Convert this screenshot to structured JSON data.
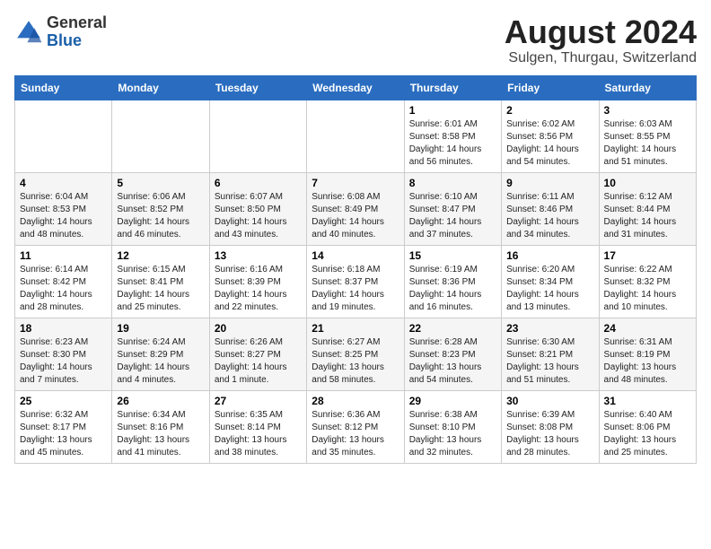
{
  "header": {
    "logo_general": "General",
    "logo_blue": "Blue",
    "month_title": "August 2024",
    "location": "Sulgen, Thurgau, Switzerland"
  },
  "weekdays": [
    "Sunday",
    "Monday",
    "Tuesday",
    "Wednesday",
    "Thursday",
    "Friday",
    "Saturday"
  ],
  "weeks": [
    [
      {
        "day": "",
        "sunrise": "",
        "sunset": "",
        "daylight": ""
      },
      {
        "day": "",
        "sunrise": "",
        "sunset": "",
        "daylight": ""
      },
      {
        "day": "",
        "sunrise": "",
        "sunset": "",
        "daylight": ""
      },
      {
        "day": "",
        "sunrise": "",
        "sunset": "",
        "daylight": ""
      },
      {
        "day": "1",
        "sunrise": "Sunrise: 6:01 AM",
        "sunset": "Sunset: 8:58 PM",
        "daylight": "Daylight: 14 hours and 56 minutes."
      },
      {
        "day": "2",
        "sunrise": "Sunrise: 6:02 AM",
        "sunset": "Sunset: 8:56 PM",
        "daylight": "Daylight: 14 hours and 54 minutes."
      },
      {
        "day": "3",
        "sunrise": "Sunrise: 6:03 AM",
        "sunset": "Sunset: 8:55 PM",
        "daylight": "Daylight: 14 hours and 51 minutes."
      }
    ],
    [
      {
        "day": "4",
        "sunrise": "Sunrise: 6:04 AM",
        "sunset": "Sunset: 8:53 PM",
        "daylight": "Daylight: 14 hours and 48 minutes."
      },
      {
        "day": "5",
        "sunrise": "Sunrise: 6:06 AM",
        "sunset": "Sunset: 8:52 PM",
        "daylight": "Daylight: 14 hours and 46 minutes."
      },
      {
        "day": "6",
        "sunrise": "Sunrise: 6:07 AM",
        "sunset": "Sunset: 8:50 PM",
        "daylight": "Daylight: 14 hours and 43 minutes."
      },
      {
        "day": "7",
        "sunrise": "Sunrise: 6:08 AM",
        "sunset": "Sunset: 8:49 PM",
        "daylight": "Daylight: 14 hours and 40 minutes."
      },
      {
        "day": "8",
        "sunrise": "Sunrise: 6:10 AM",
        "sunset": "Sunset: 8:47 PM",
        "daylight": "Daylight: 14 hours and 37 minutes."
      },
      {
        "day": "9",
        "sunrise": "Sunrise: 6:11 AM",
        "sunset": "Sunset: 8:46 PM",
        "daylight": "Daylight: 14 hours and 34 minutes."
      },
      {
        "day": "10",
        "sunrise": "Sunrise: 6:12 AM",
        "sunset": "Sunset: 8:44 PM",
        "daylight": "Daylight: 14 hours and 31 minutes."
      }
    ],
    [
      {
        "day": "11",
        "sunrise": "Sunrise: 6:14 AM",
        "sunset": "Sunset: 8:42 PM",
        "daylight": "Daylight: 14 hours and 28 minutes."
      },
      {
        "day": "12",
        "sunrise": "Sunrise: 6:15 AM",
        "sunset": "Sunset: 8:41 PM",
        "daylight": "Daylight: 14 hours and 25 minutes."
      },
      {
        "day": "13",
        "sunrise": "Sunrise: 6:16 AM",
        "sunset": "Sunset: 8:39 PM",
        "daylight": "Daylight: 14 hours and 22 minutes."
      },
      {
        "day": "14",
        "sunrise": "Sunrise: 6:18 AM",
        "sunset": "Sunset: 8:37 PM",
        "daylight": "Daylight: 14 hours and 19 minutes."
      },
      {
        "day": "15",
        "sunrise": "Sunrise: 6:19 AM",
        "sunset": "Sunset: 8:36 PM",
        "daylight": "Daylight: 14 hours and 16 minutes."
      },
      {
        "day": "16",
        "sunrise": "Sunrise: 6:20 AM",
        "sunset": "Sunset: 8:34 PM",
        "daylight": "Daylight: 14 hours and 13 minutes."
      },
      {
        "day": "17",
        "sunrise": "Sunrise: 6:22 AM",
        "sunset": "Sunset: 8:32 PM",
        "daylight": "Daylight: 14 hours and 10 minutes."
      }
    ],
    [
      {
        "day": "18",
        "sunrise": "Sunrise: 6:23 AM",
        "sunset": "Sunset: 8:30 PM",
        "daylight": "Daylight: 14 hours and 7 minutes."
      },
      {
        "day": "19",
        "sunrise": "Sunrise: 6:24 AM",
        "sunset": "Sunset: 8:29 PM",
        "daylight": "Daylight: 14 hours and 4 minutes."
      },
      {
        "day": "20",
        "sunrise": "Sunrise: 6:26 AM",
        "sunset": "Sunset: 8:27 PM",
        "daylight": "Daylight: 14 hours and 1 minute."
      },
      {
        "day": "21",
        "sunrise": "Sunrise: 6:27 AM",
        "sunset": "Sunset: 8:25 PM",
        "daylight": "Daylight: 13 hours and 58 minutes."
      },
      {
        "day": "22",
        "sunrise": "Sunrise: 6:28 AM",
        "sunset": "Sunset: 8:23 PM",
        "daylight": "Daylight: 13 hours and 54 minutes."
      },
      {
        "day": "23",
        "sunrise": "Sunrise: 6:30 AM",
        "sunset": "Sunset: 8:21 PM",
        "daylight": "Daylight: 13 hours and 51 minutes."
      },
      {
        "day": "24",
        "sunrise": "Sunrise: 6:31 AM",
        "sunset": "Sunset: 8:19 PM",
        "daylight": "Daylight: 13 hours and 48 minutes."
      }
    ],
    [
      {
        "day": "25",
        "sunrise": "Sunrise: 6:32 AM",
        "sunset": "Sunset: 8:17 PM",
        "daylight": "Daylight: 13 hours and 45 minutes."
      },
      {
        "day": "26",
        "sunrise": "Sunrise: 6:34 AM",
        "sunset": "Sunset: 8:16 PM",
        "daylight": "Daylight: 13 hours and 41 minutes."
      },
      {
        "day": "27",
        "sunrise": "Sunrise: 6:35 AM",
        "sunset": "Sunset: 8:14 PM",
        "daylight": "Daylight: 13 hours and 38 minutes."
      },
      {
        "day": "28",
        "sunrise": "Sunrise: 6:36 AM",
        "sunset": "Sunset: 8:12 PM",
        "daylight": "Daylight: 13 hours and 35 minutes."
      },
      {
        "day": "29",
        "sunrise": "Sunrise: 6:38 AM",
        "sunset": "Sunset: 8:10 PM",
        "daylight": "Daylight: 13 hours and 32 minutes."
      },
      {
        "day": "30",
        "sunrise": "Sunrise: 6:39 AM",
        "sunset": "Sunset: 8:08 PM",
        "daylight": "Daylight: 13 hours and 28 minutes."
      },
      {
        "day": "31",
        "sunrise": "Sunrise: 6:40 AM",
        "sunset": "Sunset: 8:06 PM",
        "daylight": "Daylight: 13 hours and 25 minutes."
      }
    ]
  ]
}
